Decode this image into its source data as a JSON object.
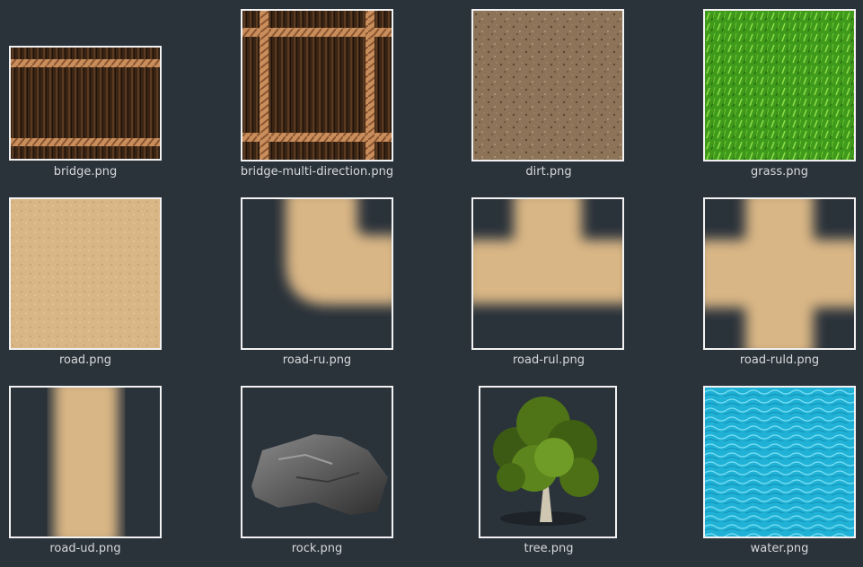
{
  "files": [
    {
      "name": "bridge.png",
      "icon": "bridge-thumbnail"
    },
    {
      "name": "bridge-multi-direction.png",
      "icon": "bridge-multi-direction-thumbnail"
    },
    {
      "name": "dirt.png",
      "icon": "dirt-thumbnail"
    },
    {
      "name": "grass.png",
      "icon": "grass-thumbnail"
    },
    {
      "name": "road.png",
      "icon": "road-thumbnail"
    },
    {
      "name": "road-ru.png",
      "icon": "road-ru-thumbnail"
    },
    {
      "name": "road-rul.png",
      "icon": "road-rul-thumbnail"
    },
    {
      "name": "road-ruld.png",
      "icon": "road-ruld-thumbnail"
    },
    {
      "name": "road-ud.png",
      "icon": "road-ud-thumbnail"
    },
    {
      "name": "rock.png",
      "icon": "rock-thumbnail"
    },
    {
      "name": "tree.png",
      "icon": "tree-thumbnail"
    },
    {
      "name": "water.png",
      "icon": "water-thumbnail"
    }
  ],
  "colors": {
    "background": "#2a323a",
    "thumbnail_border": "#f2f2f2",
    "label": "#d6d9dc"
  }
}
